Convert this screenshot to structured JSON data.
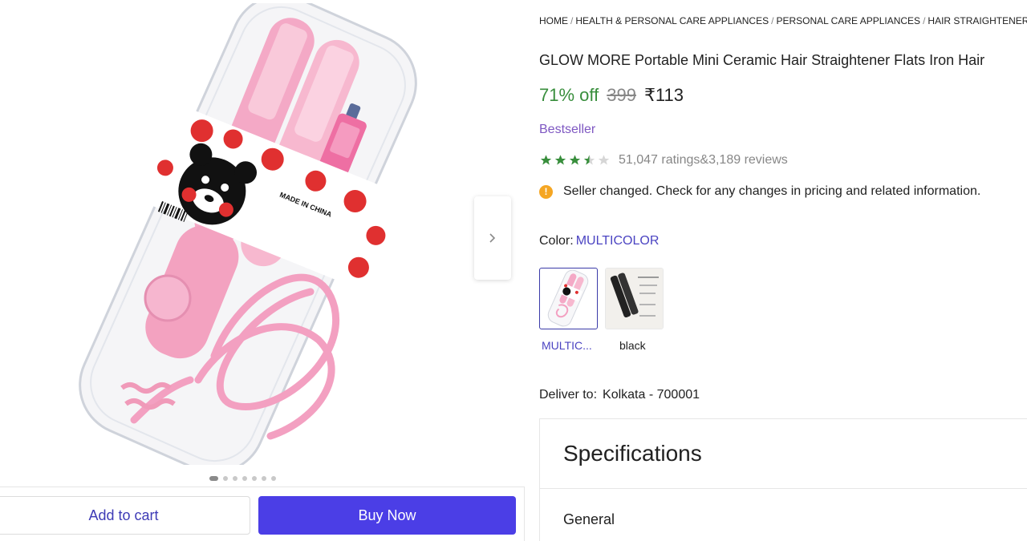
{
  "breadcrumb": [
    "HOME",
    "HEALTH & PERSONAL CARE APPLIANCES",
    "PERSONAL CARE APPLIANCES",
    "HAIR STRAIGHTENERS"
  ],
  "product": {
    "title": "GLOW MORE Portable Mini Ceramic Hair Straightener Flats Iron Hair",
    "discount": "71% off",
    "mrp": "399",
    "price": "₹113",
    "badge": "Bestseller",
    "rating_value": 3.5,
    "ratings_text": "51,047 ratings",
    "amp": "&",
    "reviews_text": "3,189 reviews",
    "notice": "Seller changed. Check for any changes in pricing and related information.",
    "image_text": "MADE IN CHINA"
  },
  "color": {
    "label": "Color:",
    "selected": "MULTICOLOR",
    "options": [
      {
        "label": "MULTIC..."
      },
      {
        "label": "black"
      }
    ]
  },
  "delivery": {
    "label": "Deliver to:",
    "location": "Kolkata - 700001"
  },
  "specs": {
    "title": "Specifications",
    "first_section": "General"
  },
  "gallery": {
    "dot_count": 7,
    "active_dot": 0
  },
  "actions": {
    "add_to_cart": "Add to cart",
    "buy_now": "Buy Now"
  },
  "colors": {
    "discount_green": "#388e3c",
    "star_green": "#388e3c",
    "bestseller_purple": "#7e57c2",
    "buy_button": "#4b3ee6",
    "link_blue": "#4b44c2",
    "info_orange": "#f5a623",
    "product_pink": "#f6b3cc"
  },
  "icons": {
    "next": "chevron-right-icon",
    "info": "info-icon",
    "star": "star-icon"
  }
}
